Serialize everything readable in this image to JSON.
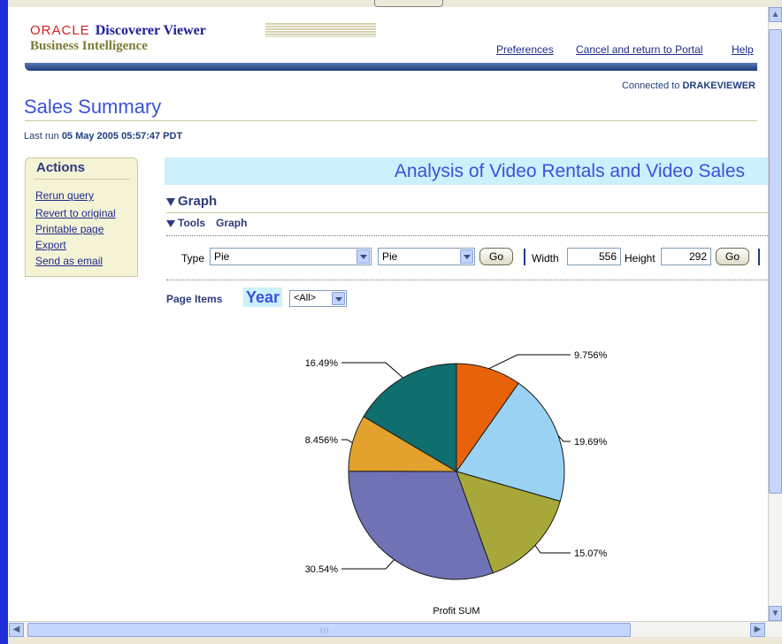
{
  "header": {
    "oracle": "ORACLE",
    "product": "Discoverer Viewer",
    "subtitle": "Business Intelligence",
    "links": [
      "Preferences",
      "Cancel and return to Portal",
      "Help"
    ],
    "connected_prefix": "Connected to",
    "connected_user": "DRAKEVIEWER"
  },
  "page": {
    "title": "Sales Summary",
    "last_run_label": "Last run",
    "last_run_value": "05 May 2005 05:57:47 PDT"
  },
  "actions": {
    "heading": "Actions",
    "items": [
      "Rerun query",
      "Revert to original",
      "Printable page",
      "Export",
      "Send as email"
    ]
  },
  "worksheet": {
    "title": "Analysis of Video Rentals and Video Sales",
    "graph_heading": "Graph",
    "tools_label": "Tools",
    "tools_sub": "Graph"
  },
  "toolbar": {
    "type_label": "Type",
    "type_value": "Pie",
    "subtype_value": "Pie",
    "go_label": "Go",
    "width_label": "Width",
    "width_value": "556",
    "height_label": "Height",
    "height_value": "292"
  },
  "page_items": {
    "label": "Page Items",
    "item": "Year",
    "value": "<All>"
  },
  "colors": {
    "accent_blue": "#3a52d8",
    "brand_red": "#d41f1f",
    "header_bar": "#1e3f7f"
  },
  "chart_data": {
    "type": "pie",
    "title": "Profit SUM",
    "slices": [
      {
        "label": "9.756%",
        "value": 9.756,
        "color": "#e8620a"
      },
      {
        "label": "19.69%",
        "value": 19.69,
        "color": "#9ad2f3"
      },
      {
        "label": "15.07%",
        "value": 15.07,
        "color": "#a8a83a"
      },
      {
        "label": "30.54%",
        "value": 30.54,
        "color": "#6f72b4"
      },
      {
        "label": "8.456%",
        "value": 8.456,
        "color": "#e3a12d"
      },
      {
        "label": "16.49%",
        "value": 16.49,
        "color": "#0f6e6e"
      }
    ]
  }
}
